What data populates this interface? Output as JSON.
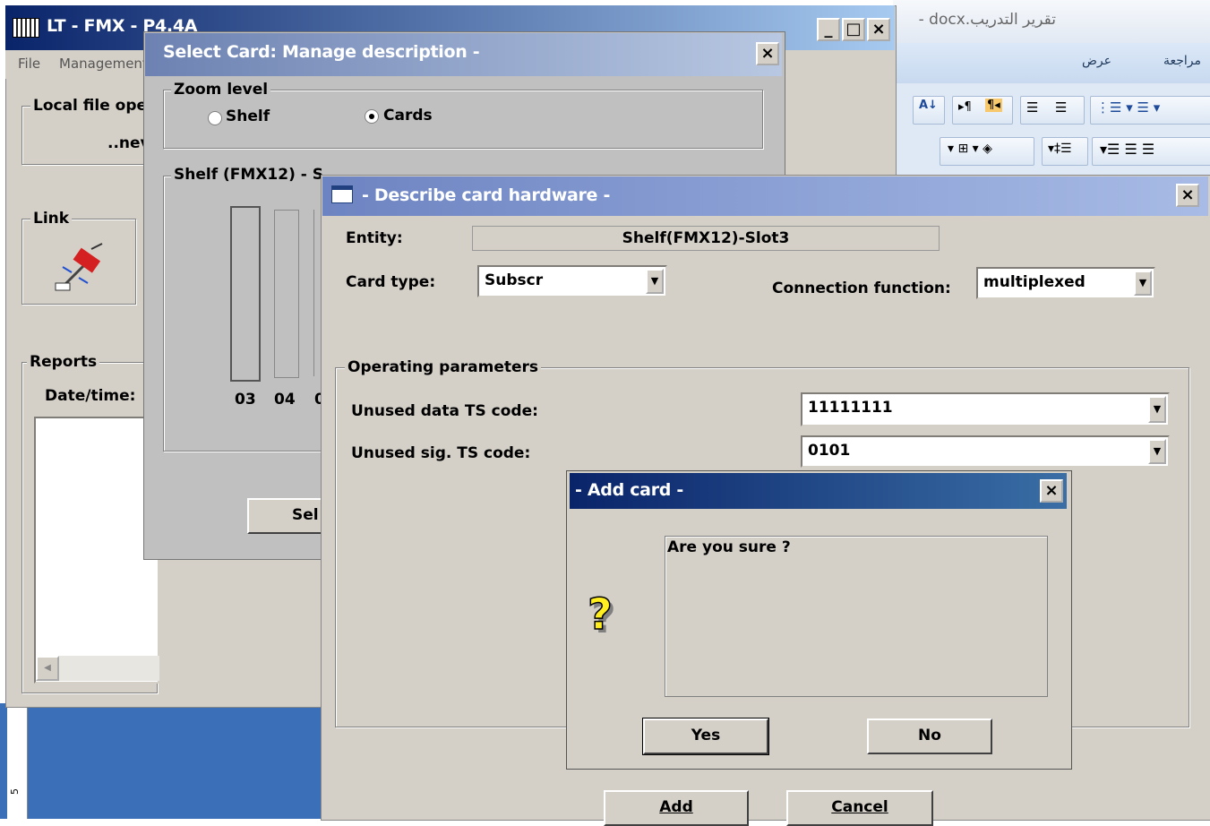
{
  "word": {
    "title": "تقرير التدريب.docx -",
    "ribbon_tabs": [
      "مراجعة",
      "عرض"
    ],
    "ruler_mark": "5"
  },
  "lt": {
    "title": "LT - FMX - P4.4A",
    "menu": [
      "File",
      "Management"
    ],
    "local_file": {
      "label": "Local file ope",
      "value": "..nev"
    },
    "link_label": "Link",
    "reports_label": "Reports",
    "date_time_label": "Date/time:"
  },
  "select_card": {
    "title": "Select Card: Manage description -",
    "zoom_label": "Zoom level",
    "options": [
      {
        "label": "Shelf",
        "selected": false
      },
      {
        "label": "Cards",
        "selected": true
      }
    ],
    "shelf_label": "Shelf (FMX12) - S",
    "slots": [
      "03",
      "04",
      "0"
    ],
    "select_button": "Sel"
  },
  "describe": {
    "title": "- Describe card hardware -",
    "entity_label": "Entity:",
    "entity_value": "Shelf(FMX12)-Slot3",
    "card_type_label": "Card type:",
    "card_type_value": "Subscr",
    "connection_label": "Connection function:",
    "connection_value": "multiplexed",
    "operating_label": "Operating parameters",
    "unused_data_label": "Unused data TS code:",
    "unused_data_value": "11111111",
    "unused_sig_label": "Unused sig. TS code:",
    "unused_sig_value": "0101",
    "add_button": "Add",
    "cancel_button": "Cancel"
  },
  "add_card": {
    "title": "- Add card -",
    "message": "Are you sure ?",
    "yes_button": "Yes",
    "no_button": "No"
  },
  "colors": {
    "active_title": "#0a246a",
    "inactive_title": "#6d84c2",
    "face": "#d4d0c8"
  }
}
